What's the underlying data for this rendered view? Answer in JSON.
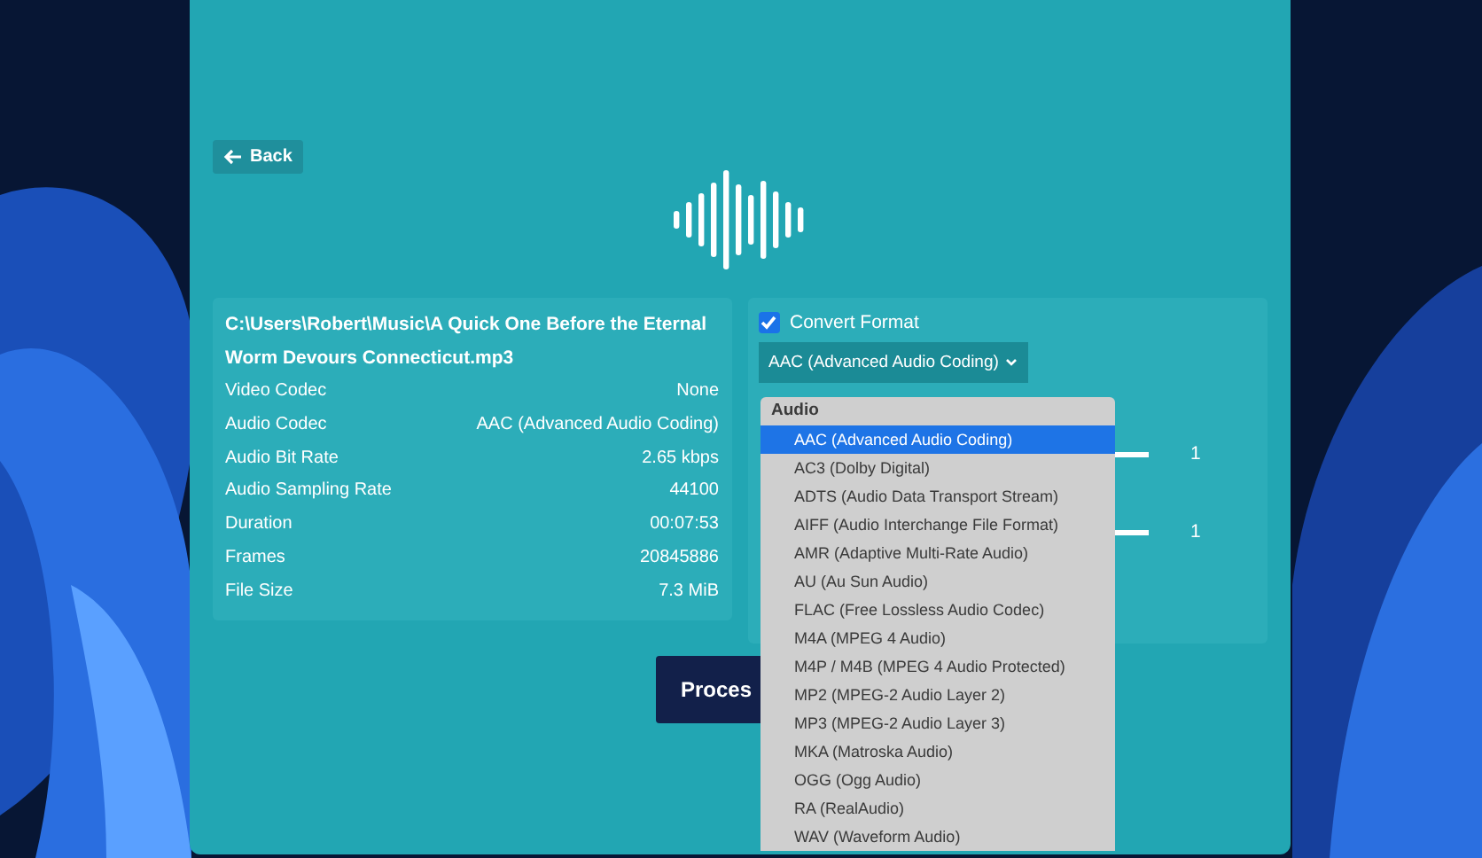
{
  "back_button": {
    "label": "Back"
  },
  "file_info": {
    "path": "C:\\Users\\Robert\\Music\\A Quick One Before the Eternal Worm Devours Connecticut.mp3",
    "properties": [
      {
        "label": "Video Codec",
        "value": "None"
      },
      {
        "label": "Audio Codec",
        "value": "AAC (Advanced Audio Coding)"
      },
      {
        "label": "Audio Bit Rate",
        "value": "2.65 kbps"
      },
      {
        "label": "Audio Sampling Rate",
        "value": "44100"
      },
      {
        "label": "Duration",
        "value": "00:07:53"
      },
      {
        "label": "Frames",
        "value": "20845886"
      },
      {
        "label": "File Size",
        "value": "7.3 MiB"
      }
    ]
  },
  "convert": {
    "checkbox": {
      "label": "Convert Format",
      "checked": true
    },
    "format_select": {
      "value": "AAC (Advanced Audio Coding)"
    },
    "sliders": [
      {
        "level": 1,
        "reading": "1"
      },
      {
        "level": 1,
        "reading": "1"
      }
    ],
    "dropdown": {
      "group": "Audio",
      "options": [
        {
          "label": "AAC (Advanced Audio Coding)",
          "selected": true
        },
        {
          "label": "AC3 (Dolby Digital)",
          "selected": false
        },
        {
          "label": "ADTS (Audio Data Transport Stream)",
          "selected": false
        },
        {
          "label": "AIFF (Audio Interchange File Format)",
          "selected": false
        },
        {
          "label": "AMR (Adaptive Multi-Rate Audio)",
          "selected": false
        },
        {
          "label": "AU (Au Sun Audio)",
          "selected": false
        },
        {
          "label": "FLAC (Free Lossless Audio Codec)",
          "selected": false
        },
        {
          "label": "M4A (MPEG 4 Audio)",
          "selected": false
        },
        {
          "label": "M4P / M4B (MPEG 4 Audio Protected)",
          "selected": false
        },
        {
          "label": "MP2 (MPEG-2 Audio Layer 2)",
          "selected": false
        },
        {
          "label": "MP3 (MPEG-2 Audio Layer 3)",
          "selected": false
        },
        {
          "label": "MKA (Matroska Audio)",
          "selected": false
        },
        {
          "label": "OGG (Ogg Audio)",
          "selected": false
        },
        {
          "label": "RA (RealAudio)",
          "selected": false
        },
        {
          "label": "WAV (Waveform Audio)",
          "selected": false
        }
      ]
    }
  },
  "process_button": {
    "label": "Proces"
  }
}
